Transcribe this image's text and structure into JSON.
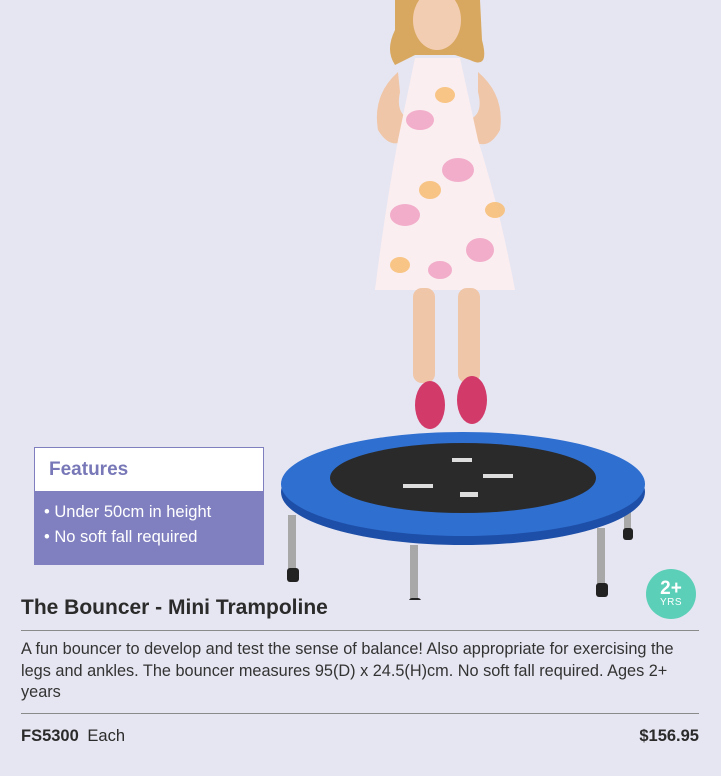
{
  "colors": {
    "background": "#e6e6f2",
    "features_accent": "#8080c0",
    "badge": "#5ccfb8",
    "trampoline_mat_frame": "#2f6fd0"
  },
  "product_image": {
    "icon": "child-jumping-on-mini-trampoline"
  },
  "features": {
    "title": "Features",
    "items": [
      "• Under 50cm in height",
      "• No soft fall required"
    ]
  },
  "age_badge": {
    "value": "2+",
    "unit": "YRS"
  },
  "product": {
    "title": "The Bouncer - Mini Trampoline",
    "description": "A fun bouncer to develop and test the sense of balance! Also appropriate for exercising the legs and ankles. The bouncer measures 95(D) x 24.5(H)cm. No soft fall required. Ages 2+ years",
    "code": "FS5300",
    "unit": "Each",
    "price": "$156.95"
  }
}
